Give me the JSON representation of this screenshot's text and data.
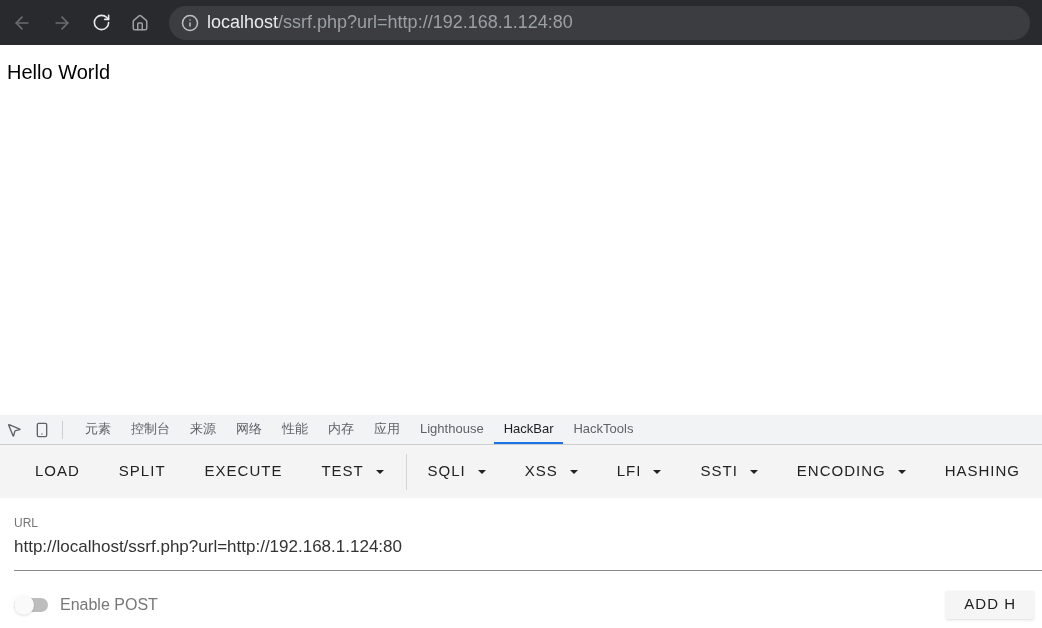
{
  "browser": {
    "url_host": "localhost",
    "url_rest": "/ssrf.php?url=http://192.168.1.124:80"
  },
  "page": {
    "text": "Hello World"
  },
  "devtools_tabs": [
    {
      "label": "元素",
      "selected": false
    },
    {
      "label": "控制台",
      "selected": false
    },
    {
      "label": "来源",
      "selected": false
    },
    {
      "label": "网络",
      "selected": false
    },
    {
      "label": "性能",
      "selected": false
    },
    {
      "label": "内存",
      "selected": false
    },
    {
      "label": "应用",
      "selected": false
    },
    {
      "label": "Lighthouse",
      "selected": false
    },
    {
      "label": "HackBar",
      "selected": true
    },
    {
      "label": "HackTools",
      "selected": false
    }
  ],
  "hackbar_toolbar": [
    {
      "label": "LOAD",
      "dropdown": false
    },
    {
      "label": "SPLIT",
      "dropdown": false
    },
    {
      "label": "EXECUTE",
      "dropdown": false
    },
    {
      "label": "TEST",
      "dropdown": true,
      "divider_after": true
    },
    {
      "label": "SQLI",
      "dropdown": true
    },
    {
      "label": "XSS",
      "dropdown": true
    },
    {
      "label": "LFI",
      "dropdown": true
    },
    {
      "label": "SSTI",
      "dropdown": true
    },
    {
      "label": "ENCODING",
      "dropdown": true
    },
    {
      "label": "HASHING",
      "dropdown": false
    }
  ],
  "url_field": {
    "label": "URL",
    "value": "http://localhost/ssrf.php?url=http://192.168.1.124:80"
  },
  "enable_post": {
    "label": "Enable POST",
    "on": false
  },
  "add_header_button": {
    "label": "ADD H"
  }
}
